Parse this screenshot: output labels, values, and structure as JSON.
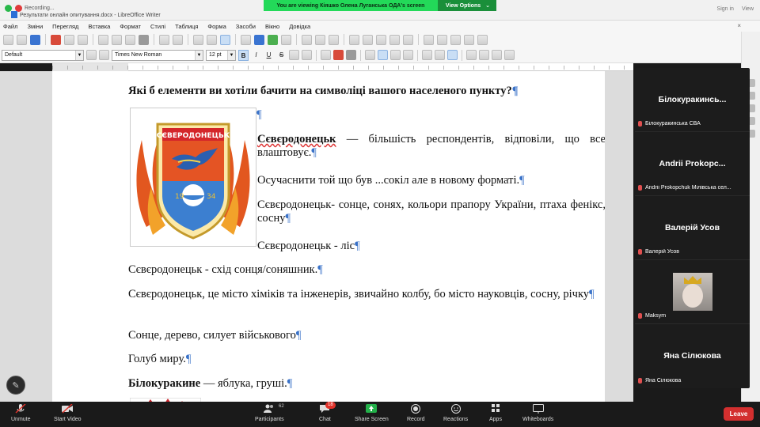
{
  "zoom_banner": {
    "message": "You are viewing Кіяшко Олена Луганська ОДА's screen",
    "view_options": "View Options"
  },
  "writer": {
    "recording_label": "Recording...",
    "window_title": "Результати онлайн опитування.docx - LibreOffice Writer",
    "sign_in": "Sign in",
    "view": "View",
    "menu": [
      "Файл",
      "Зміни",
      "Перегляд",
      "Вставка",
      "Формат",
      "Стилі",
      "Таблиця",
      "Форма",
      "Засоби",
      "Вікно",
      "Довідка"
    ],
    "style_value": "Default",
    "font_value": "Times New Roman",
    "size_value": "12 pt",
    "format_buttons": [
      "B",
      "I",
      "U",
      "S"
    ]
  },
  "document": {
    "heading": "Які б елементи ви хотіли бачити на символіці вашого населеного пункту?",
    "pilcrow": "¶",
    "emblem_banner": "СЄВЕРОДОНЕЦЬК",
    "emblem_year1": "19",
    "emblem_year2": "34",
    "p1_bold": "Сєвєродонецьк",
    "p1_rest": " — більшість респондентів, відповіли, що все влаштовує.",
    "p2": "Осучаснити той що був ...сокіл але в новому форматі.",
    "p3": "Сєвєродонецьк- сонце, сонях, кольори прапору України, птаха фенікс, сосну",
    "p4": "Сєвєродонецьк - ліс",
    "p5": "Сєвєродонецьк - схід сонця/соняшник.",
    "p6": "Сєвєродонецьк, це місто хіміків та інженерів, звичайно колбу, бо місто науковців, сосну, річку",
    "p7": "Сонце, дерево, силует військового",
    "p8": "Голуб миру.",
    "p9_bold": "Білокуракине",
    "p9_rest": " — яблука, груші."
  },
  "participants": [
    {
      "display": "Білокуракинсь...",
      "label": "Білокуракинська СВА"
    },
    {
      "display": "Andrii Prokopc...",
      "label": "Andrii Prokopchuk Мілівська сел..."
    },
    {
      "display": "Валерій Усов",
      "label": "Валерій Усов"
    },
    {
      "display": "",
      "label": "Maksym"
    },
    {
      "display": "Яна Сілюкова",
      "label": "Яна Сілюкова"
    }
  ],
  "zoom_controls": {
    "unmute": "Unmute",
    "start_video": "Start Video",
    "participants": "Participants",
    "participants_count": "62",
    "chat": "Chat",
    "chat_badge": "18",
    "share_screen": "Share Screen",
    "record": "Record",
    "reactions": "Reactions",
    "apps": "Apps",
    "whiteboards": "Whiteboards",
    "leave": "Leave"
  },
  "colors": {
    "zoom_green": "#23d959",
    "leave_red": "#d32f2f",
    "pilcrow_blue": "#3a72c8"
  }
}
